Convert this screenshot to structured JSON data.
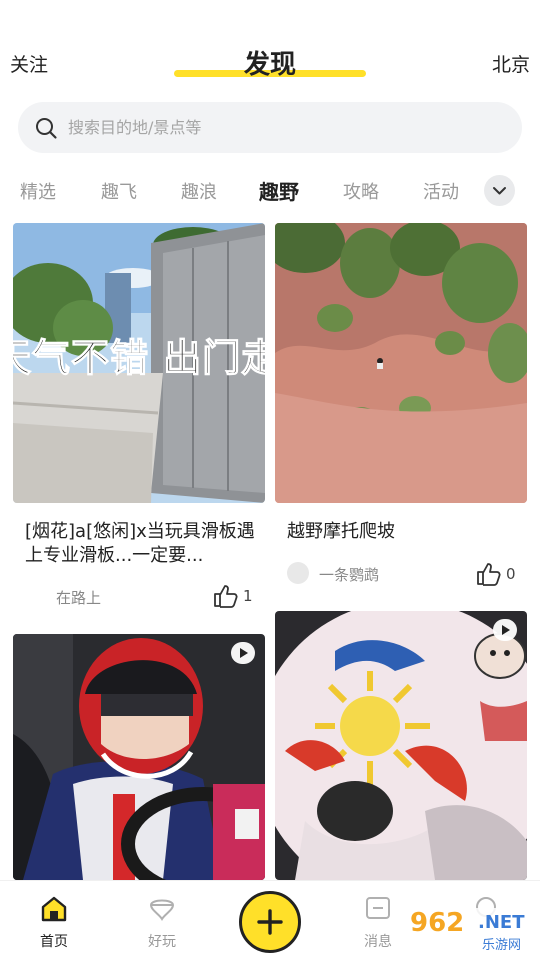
{
  "header": {
    "left_label": "关注",
    "title": "发现",
    "right_label": "北京"
  },
  "search": {
    "placeholder": "搜索目的地/景点等"
  },
  "tabs": [
    {
      "label": "精选",
      "active": false
    },
    {
      "label": "趣飞",
      "active": false
    },
    {
      "label": "趣浪",
      "active": false
    },
    {
      "label": "趣野",
      "active": true
    },
    {
      "label": "攻略",
      "active": false
    },
    {
      "label": "活动",
      "active": false
    }
  ],
  "feed": [
    {
      "overlay_text": "天气不错 出门走走",
      "title": "[烟花]a[悠闲]x当玩具滑板遇上专业滑板...一定要...",
      "author": "在路上",
      "likes": "1"
    },
    {
      "title": "越野摩托爬坡",
      "author": "一条鹦鹉",
      "likes": "0"
    },
    {
      "is_video": true
    },
    {
      "is_video": true
    }
  ],
  "tabbar": {
    "items": [
      {
        "label": "首页",
        "icon": "home-icon",
        "active": true
      },
      {
        "label": "好玩",
        "icon": "balloon-icon",
        "active": false
      },
      {
        "label": "",
        "icon": "plus-icon",
        "active": false
      },
      {
        "label": "消息",
        "icon": "message-icon",
        "active": false
      }
    ]
  },
  "watermark": {
    "number": "962",
    "net": ".NET",
    "sub": "乐游网"
  },
  "colors": {
    "accent": "#ffe029",
    "text_primary": "#222222",
    "text_muted": "#999999",
    "search_bg": "#f2f3f5"
  }
}
